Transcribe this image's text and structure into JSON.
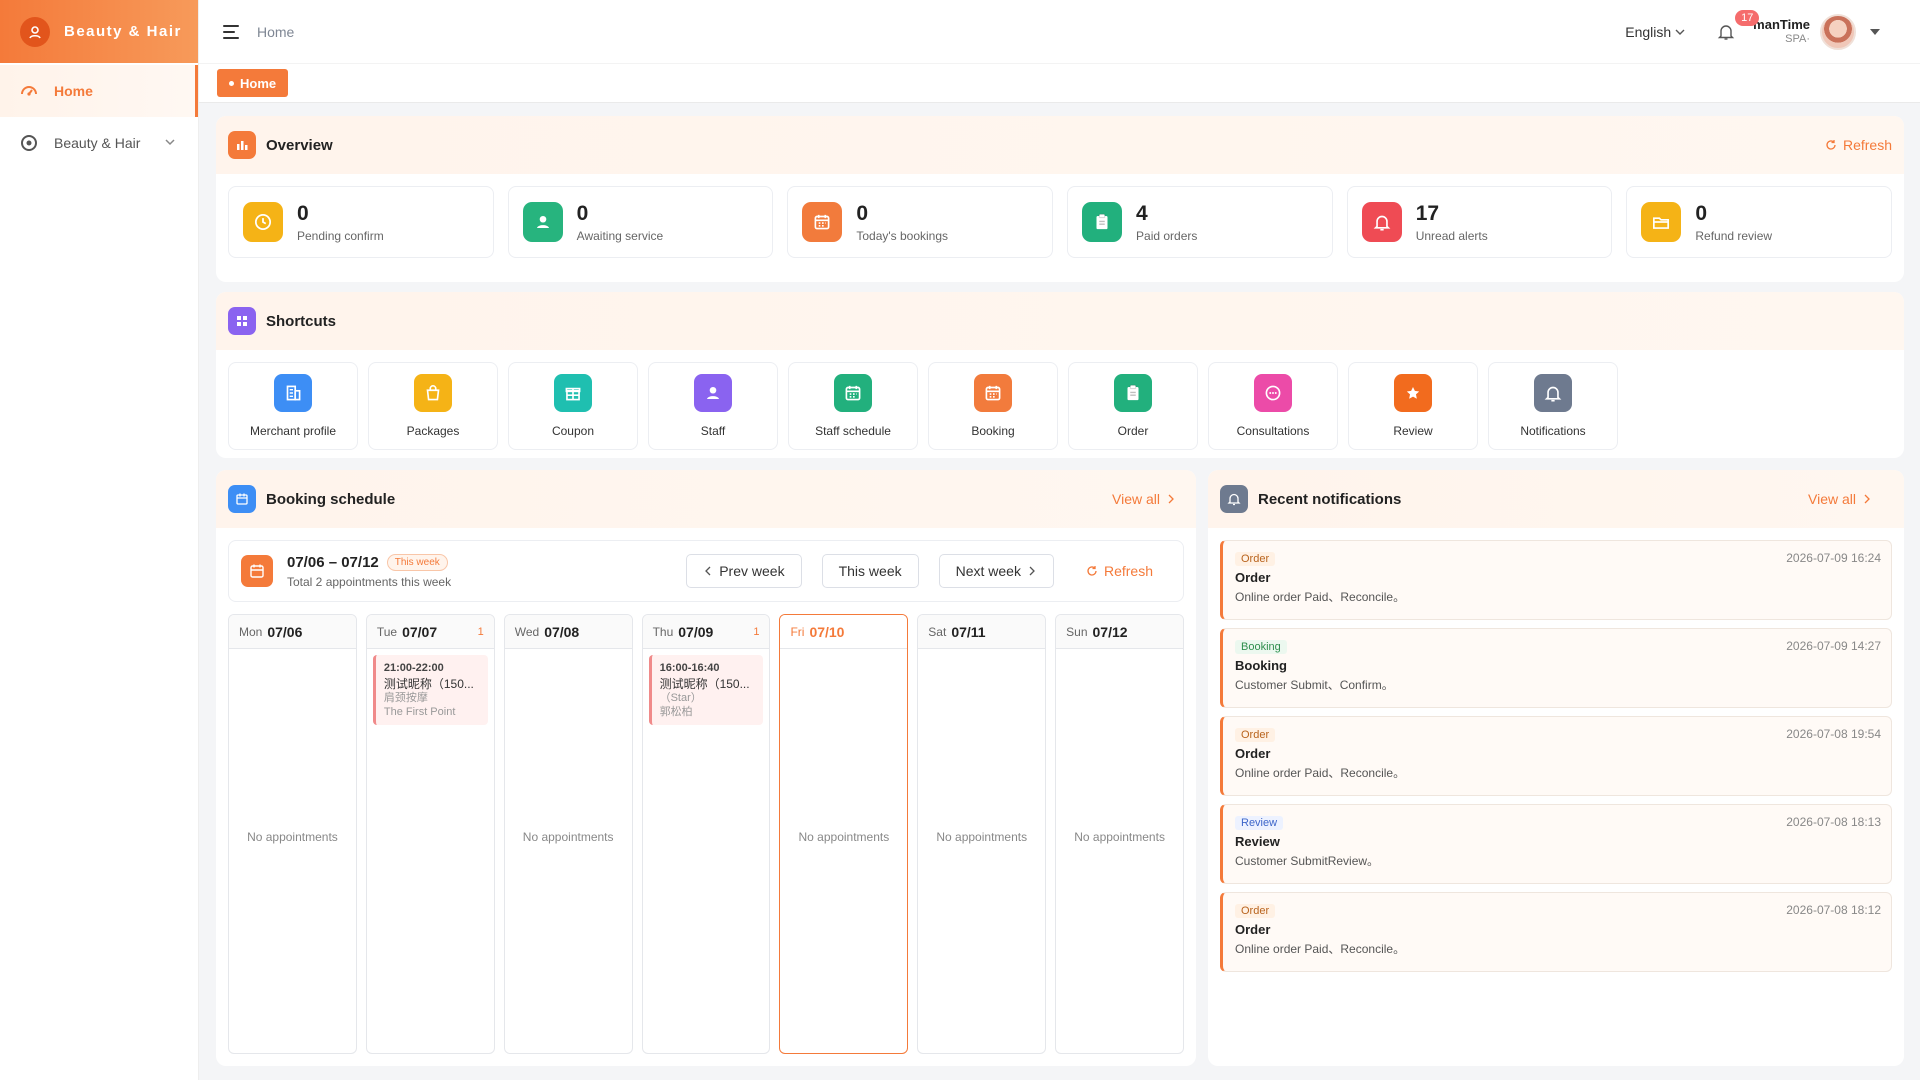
{
  "brand": {
    "name": "Beauty & Hair"
  },
  "sidebar": {
    "items": [
      {
        "label": "Home",
        "active": true
      },
      {
        "label": "Beauty & Hair",
        "active": false
      }
    ]
  },
  "header": {
    "breadcrumb": "Home",
    "language": "English",
    "notification_count": "17",
    "user_name": "manTime",
    "user_sub": "SPA·"
  },
  "tags": {
    "home": "Home"
  },
  "overview": {
    "title": "Overview",
    "refresh": "Refresh",
    "stats": [
      {
        "value": "0",
        "label": "Pending confirm",
        "color": "#f5b316",
        "icon": "clock-icon"
      },
      {
        "value": "0",
        "label": "Awaiting service",
        "color": "#27b47e",
        "icon": "user-icon"
      },
      {
        "value": "0",
        "label": "Today's bookings",
        "color": "#f27b3c",
        "icon": "calendar-icon"
      },
      {
        "value": "4",
        "label": "Paid orders",
        "color": "#22b07d",
        "icon": "clipboard-icon"
      },
      {
        "value": "17",
        "label": "Unread alerts",
        "color": "#ef4b54",
        "icon": "bell-icon"
      },
      {
        "value": "0",
        "label": "Refund review",
        "color": "#f5b316",
        "icon": "folder-icon"
      }
    ]
  },
  "shortcuts": {
    "title": "Shortcuts",
    "items": [
      {
        "label": "Merchant profile",
        "color": "#3d8ef5",
        "icon": "building-icon"
      },
      {
        "label": "Packages",
        "color": "#f5b316",
        "icon": "bag-icon"
      },
      {
        "label": "Coupon",
        "color": "#1fbfb0",
        "icon": "gift-icon"
      },
      {
        "label": "Staff",
        "color": "#8a63f0",
        "icon": "user-icon"
      },
      {
        "label": "Staff schedule",
        "color": "#22b07d",
        "icon": "calendar-icon"
      },
      {
        "label": "Booking",
        "color": "#f27b3c",
        "icon": "calendar-icon"
      },
      {
        "label": "Order",
        "color": "#22b07d",
        "icon": "clipboard-icon"
      },
      {
        "label": "Consultations",
        "color": "#ec4ba8",
        "icon": "chat-icon"
      },
      {
        "label": "Review",
        "color": "#f26b1e",
        "icon": "star-icon"
      },
      {
        "label": "Notifications",
        "color": "#6e7a8f",
        "icon": "bell-icon"
      }
    ]
  },
  "booking": {
    "title": "Booking schedule",
    "view_all": "View all",
    "range": "07/06 – 07/12",
    "badge": "This week",
    "total": "Total 2 appointments this week",
    "prev": "Prev week",
    "this_week": "This week",
    "next": "Next week",
    "refresh": "Refresh",
    "empty": "No appointments",
    "days": [
      {
        "dow": "Mon",
        "date": "07/06",
        "count": ""
      },
      {
        "dow": "Tue",
        "date": "07/07",
        "count": "1",
        "appt": {
          "time": "21:00-22:00",
          "name": "测试昵称（150...",
          "service": "肩颈按摩",
          "staff": "The First Point"
        }
      },
      {
        "dow": "Wed",
        "date": "07/08",
        "count": ""
      },
      {
        "dow": "Thu",
        "date": "07/09",
        "count": "1",
        "appt": {
          "time": "16:00-16:40",
          "name": "测试昵称（150...",
          "service": "（Star）",
          "staff": "郭松柏"
        }
      },
      {
        "dow": "Fri",
        "date": "07/10",
        "count": "",
        "today": true
      },
      {
        "dow": "Sat",
        "date": "07/11",
        "count": ""
      },
      {
        "dow": "Sun",
        "date": "07/12",
        "count": ""
      }
    ]
  },
  "notifications": {
    "title": "Recent notifications",
    "view_all": "View all",
    "items": [
      {
        "tag": "Order",
        "kind": "order",
        "time": "2026-07-09 16:24",
        "title": "Order",
        "body": "Online order Paid、Reconcile。"
      },
      {
        "tag": "Booking",
        "kind": "booking",
        "time": "2026-07-09 14:27",
        "title": "Booking",
        "body": "Customer Submit、Confirm。"
      },
      {
        "tag": "Order",
        "kind": "order",
        "time": "2026-07-08 19:54",
        "title": "Order",
        "body": "Online order Paid、Reconcile。"
      },
      {
        "tag": "Review",
        "kind": "review",
        "time": "2026-07-08 18:13",
        "title": "Review",
        "body": "Customer SubmitReview。"
      },
      {
        "tag": "Order",
        "kind": "order",
        "time": "2026-07-08 18:12",
        "title": "Order",
        "body": "Online order Paid、Reconcile。"
      }
    ]
  },
  "colors": {
    "accent": "#f47a3a",
    "accent_light": "#fff4ec"
  }
}
